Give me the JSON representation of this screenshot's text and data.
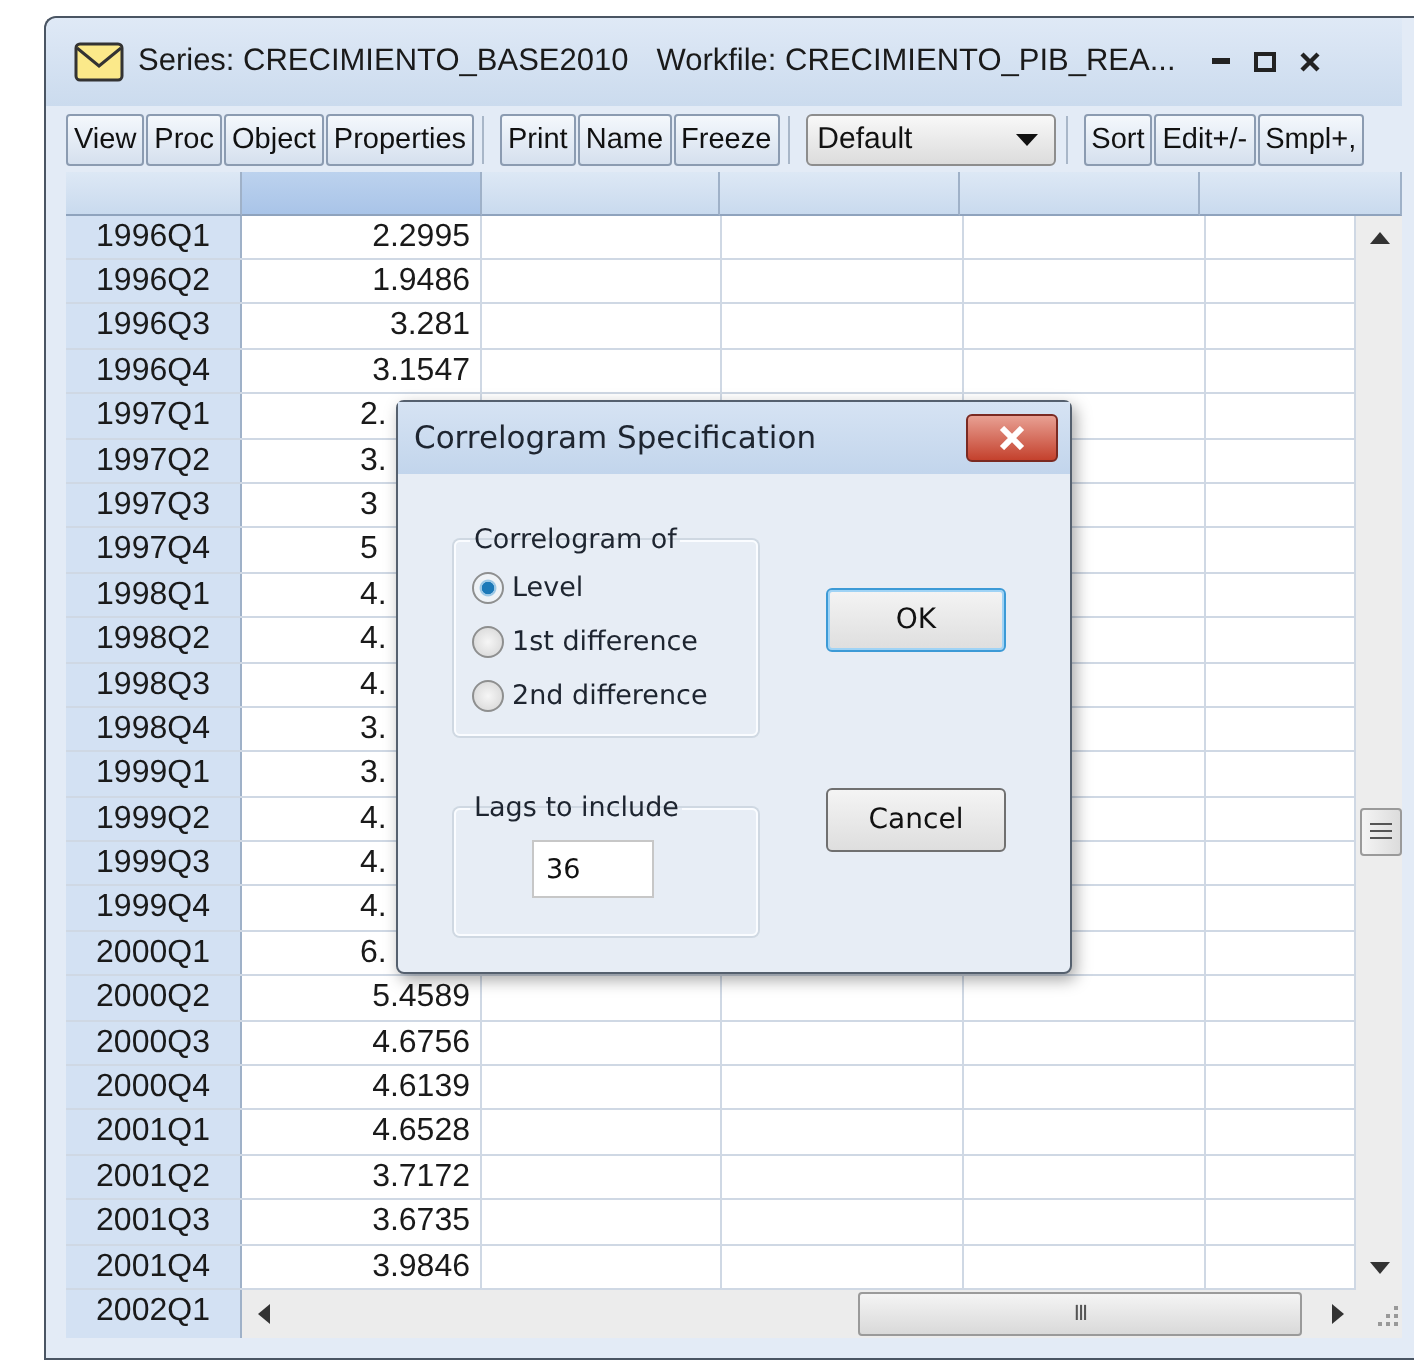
{
  "window": {
    "series_title": "Series: CRECIMIENTO_BASE2010",
    "workfile_title": "Workfile: CRECIMIENTO_PIB_REA..."
  },
  "toolbar": {
    "groups": [
      [
        "View",
        "Proc",
        "Object",
        "Properties"
      ],
      [
        "Print",
        "Name",
        "Freeze"
      ]
    ],
    "dropdown": "Default",
    "tail": [
      "Sort",
      "Edit+/-",
      "Smpl+,"
    ]
  },
  "table": {
    "columns": [
      {
        "selected": true
      },
      {
        "selected": false
      },
      {
        "selected": false
      },
      {
        "selected": false
      },
      {
        "selected": false
      }
    ],
    "rows": [
      {
        "label": "1996Q1",
        "value": "2.2995",
        "cut": false
      },
      {
        "label": "1996Q2",
        "value": "1.9486",
        "cut": false
      },
      {
        "label": "1996Q3",
        "value": "3.281",
        "cut": false
      },
      {
        "label": "1996Q4",
        "value": "3.1547",
        "cut": false
      },
      {
        "label": "1997Q1",
        "value": "2.",
        "cut": true
      },
      {
        "label": "1997Q2",
        "value": "3.",
        "cut": true
      },
      {
        "label": "1997Q3",
        "value": "3",
        "cut": true
      },
      {
        "label": "1997Q4",
        "value": "5",
        "cut": true
      },
      {
        "label": "1998Q1",
        "value": "4.",
        "cut": true
      },
      {
        "label": "1998Q2",
        "value": "4.",
        "cut": true
      },
      {
        "label": "1998Q3",
        "value": "4.",
        "cut": true
      },
      {
        "label": "1998Q4",
        "value": "3.",
        "cut": true
      },
      {
        "label": "1999Q1",
        "value": "3.",
        "cut": true
      },
      {
        "label": "1999Q2",
        "value": "4.",
        "cut": true
      },
      {
        "label": "1999Q3",
        "value": "4.",
        "cut": true
      },
      {
        "label": "1999Q4",
        "value": "4.",
        "cut": true
      },
      {
        "label": "2000Q1",
        "value": "6.",
        "cut": true
      },
      {
        "label": "2000Q2",
        "value": "5.4589",
        "cut": false
      },
      {
        "label": "2000Q3",
        "value": "4.6756",
        "cut": false
      },
      {
        "label": "2000Q4",
        "value": "4.6139",
        "cut": false
      },
      {
        "label": "2001Q1",
        "value": "4.6528",
        "cut": false
      },
      {
        "label": "2001Q2",
        "value": "3.7172",
        "cut": false
      },
      {
        "label": "2001Q3",
        "value": "3.6735",
        "cut": false
      },
      {
        "label": "2001Q4",
        "value": "3.9846",
        "cut": false
      }
    ],
    "last_row_label": "2002Q1",
    "hscroll_grip": "III"
  },
  "dialog": {
    "title": "Correlogram Specification",
    "group_title": "Correlogram of",
    "options": [
      {
        "label": "Level",
        "selected": true
      },
      {
        "label": "1st difference",
        "selected": false
      },
      {
        "label": "2nd difference",
        "selected": false
      }
    ],
    "lags_title": "Lags to include",
    "lags_value": "36",
    "ok": "OK",
    "cancel": "Cancel"
  }
}
